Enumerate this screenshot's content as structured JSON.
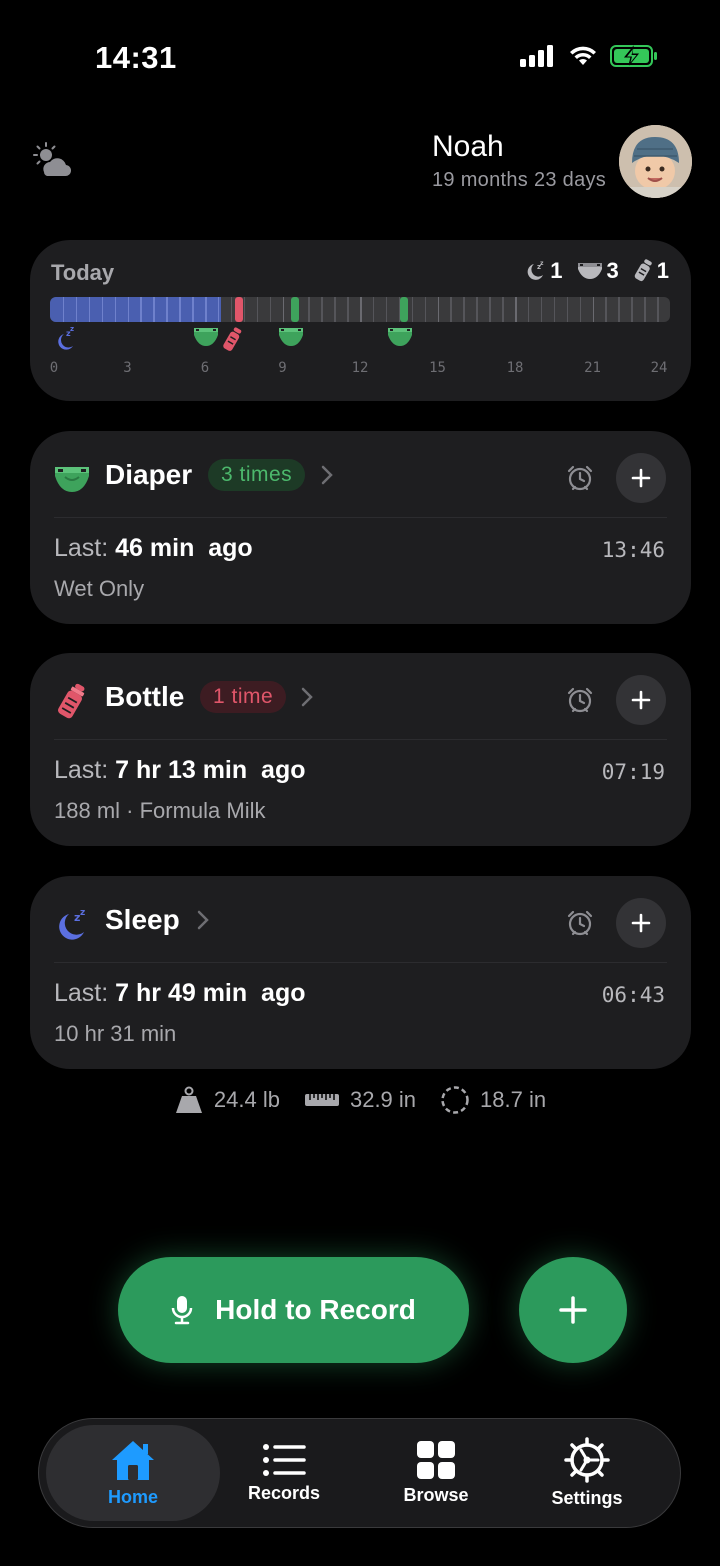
{
  "status": {
    "time": "14:31"
  },
  "profile": {
    "name": "Noah",
    "age": "19 months 23 days"
  },
  "today": {
    "label": "Today",
    "counts": {
      "sleep": "1",
      "diaper": "3",
      "bottle": "1"
    },
    "axis_ticks": [
      "0",
      "3",
      "6",
      "9",
      "12",
      "15",
      "18",
      "21",
      "24"
    ],
    "sleep_hours": [
      0,
      6.6
    ],
    "events": [
      {
        "type": "bottle",
        "hour": 7.3,
        "color": "#e0566a"
      },
      {
        "type": "diaper",
        "hour": 9.5,
        "color": "#3ea35c"
      },
      {
        "type": "diaper",
        "hour": 13.7,
        "color": "#3ea35c"
      }
    ],
    "icon_events": [
      {
        "type": "sleep",
        "hour": 0.3
      },
      {
        "type": "diaper",
        "hour": 6.0
      },
      {
        "type": "bottle",
        "hour": 7.1
      },
      {
        "type": "diaper",
        "hour": 9.3
      },
      {
        "type": "diaper",
        "hour": 13.5
      }
    ]
  },
  "cards": {
    "diaper": {
      "title": "Diaper",
      "pill": "3 times",
      "last_prefix": "Last:",
      "last_value": "46 min  ago",
      "time": "13:46",
      "detail": "Wet Only"
    },
    "bottle": {
      "title": "Bottle",
      "pill": "1 time",
      "last_prefix": "Last:",
      "last_value": "7 hr 13 min  ago",
      "time": "07:19",
      "detail": "188 ml · Formula Milk"
    },
    "sleep": {
      "title": "Sleep",
      "last_prefix": "Last:",
      "last_value": "7 hr 49 min  ago",
      "time": "06:43",
      "detail": "10 hr 31 min"
    }
  },
  "measurements": {
    "weight": "24.4 lb",
    "height": "32.9 in",
    "head": "18.7 in"
  },
  "record": {
    "label": "Hold to Record"
  },
  "tabs": {
    "home": "Home",
    "records": "Records",
    "browse": "Browse",
    "settings": "Settings"
  },
  "colors": {
    "accent_green": "#2c9a5c",
    "diaper_green": "#3ea35c",
    "bottle_pink": "#e0566a",
    "sleep_blue": "#4a5fb0",
    "tab_active_blue": "#1e9bff"
  }
}
